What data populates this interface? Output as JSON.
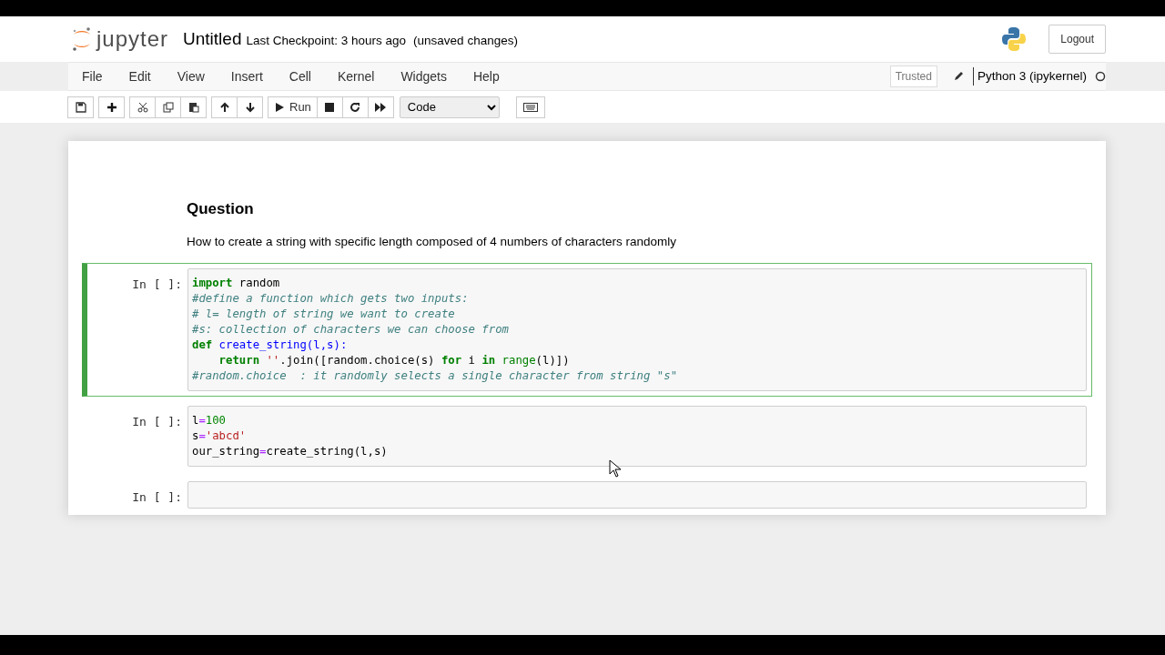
{
  "header": {
    "logo_text": "jupyter",
    "title": "Untitled",
    "checkpoint": "Last Checkpoint: 3 hours ago",
    "save_status": "(unsaved changes)",
    "logout": "Logout"
  },
  "menu": {
    "items": [
      "File",
      "Edit",
      "View",
      "Insert",
      "Cell",
      "Kernel",
      "Widgets",
      "Help"
    ],
    "trusted": "Trusted",
    "kernel": "Python 3 (ipykernel)",
    "kernel_busy": false
  },
  "toolbar": {
    "groups": [
      [
        {
          "kind": "save"
        }
      ],
      [
        {
          "kind": "add"
        }
      ],
      [
        {
          "kind": "cut"
        },
        {
          "kind": "copy"
        },
        {
          "kind": "paste"
        }
      ],
      [
        {
          "kind": "up"
        },
        {
          "kind": "down"
        }
      ],
      [
        {
          "kind": "run",
          "label": "Run"
        },
        {
          "kind": "stop"
        },
        {
          "kind": "restart"
        },
        {
          "kind": "fastforward"
        }
      ]
    ],
    "cell_type": "Code"
  },
  "cells": [
    {
      "kind": "markdown",
      "heading": "Question",
      "text": "How to create a string with specific length composed of 4 numbers of characters randomly"
    },
    {
      "kind": "code",
      "prompt": "In [ ]:",
      "selected": true,
      "lines": [
        {
          "indented": false,
          "tokens": [
            {
              "text": "import",
              "kind": "kw"
            },
            {
              "text": " random",
              "kind": "plain"
            }
          ]
        },
        {
          "indented": false,
          "tokens": [
            {
              "text": "#define a function which gets two inputs:",
              "kind": "comment"
            }
          ]
        },
        {
          "indented": false,
          "tokens": [
            {
              "text": "# l= length of string we want to create",
              "kind": "comment"
            }
          ]
        },
        {
          "indented": false,
          "tokens": [
            {
              "text": "#s: collection of characters we can choose from",
              "kind": "comment"
            }
          ]
        },
        {
          "indented": false,
          "tokens": [
            {
              "text": "def",
              "kind": "kw"
            },
            {
              "text": " create_string(l,s):",
              "kind": "def"
            }
          ]
        },
        {
          "indented": true,
          "tokens": [
            {
              "text": "return",
              "kind": "kw"
            },
            {
              "text": " ''",
              "kind": "str"
            },
            {
              "text": ".join([random.choice(s) ",
              "kind": "plain"
            },
            {
              "text": "for",
              "kind": "kw"
            },
            {
              "text": " i ",
              "kind": "plain"
            },
            {
              "text": "in",
              "kind": "kw"
            },
            {
              "text": " range",
              "kind": "builtin"
            },
            {
              "text": "(l)])",
              "kind": "plain"
            }
          ]
        },
        {
          "indented": false,
          "tokens": [
            {
              "text": "#random.choice  : it randomly selects a single character from string \"s\"",
              "kind": "comment"
            }
          ]
        }
      ]
    },
    {
      "kind": "code",
      "prompt": "In [ ]:",
      "selected": false,
      "lines": [
        {
          "indented": false,
          "tokens": [
            {
              "text": "l",
              "kind": "plain"
            },
            {
              "text": "=",
              "kind": "op"
            },
            {
              "text": "100",
              "kind": "num"
            }
          ]
        },
        {
          "indented": false,
          "tokens": [
            {
              "text": "s",
              "kind": "plain"
            },
            {
              "text": "=",
              "kind": "op"
            },
            {
              "text": "'abcd'",
              "kind": "str"
            }
          ]
        },
        {
          "indented": false,
          "tokens": [
            {
              "text": "our_string",
              "kind": "plain"
            },
            {
              "text": "=",
              "kind": "op"
            },
            {
              "text": "create_string(l,s)",
              "kind": "plain"
            }
          ]
        }
      ]
    },
    {
      "kind": "code",
      "prompt": "In [ ]:",
      "selected": false
    }
  ]
}
